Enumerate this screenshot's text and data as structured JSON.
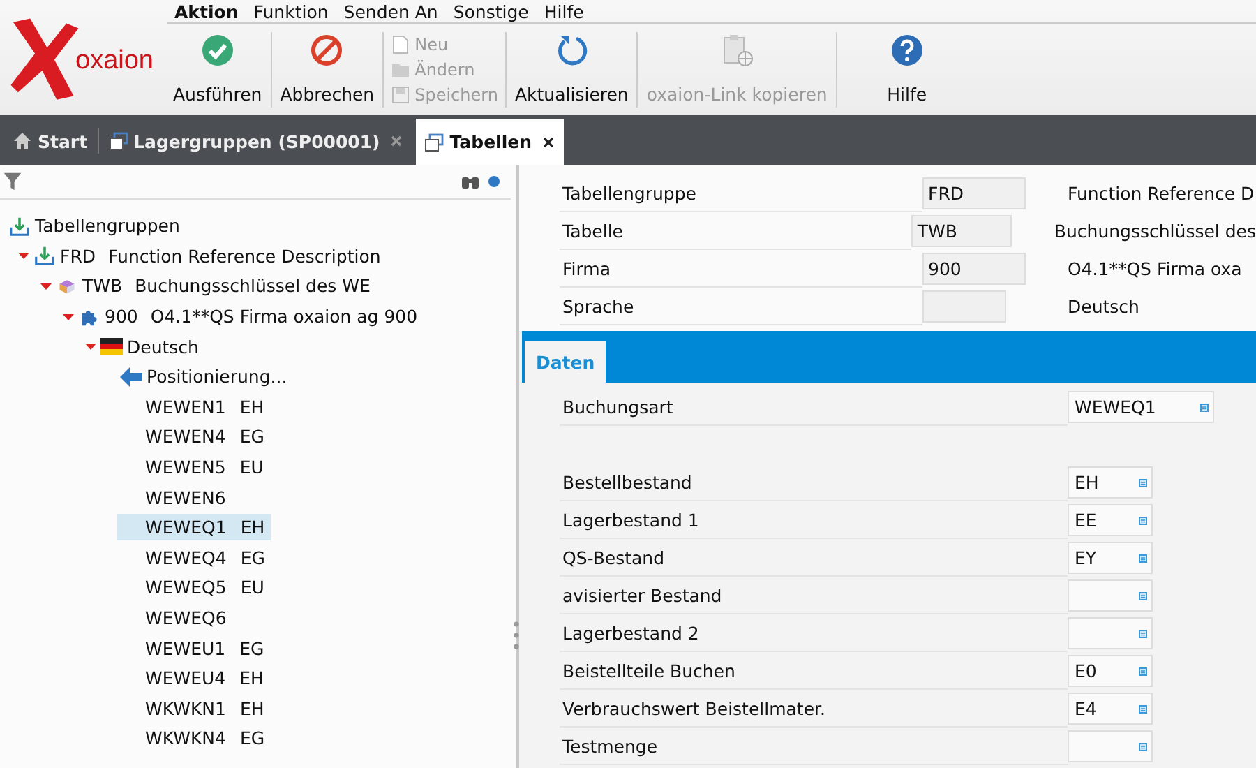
{
  "logo": {
    "text": "oxaion"
  },
  "menu": [
    {
      "label": "Aktion",
      "selected": true
    },
    {
      "label": "Funktion",
      "selected": false
    },
    {
      "label": "Senden An",
      "selected": false
    },
    {
      "label": "Sonstige",
      "selected": false
    },
    {
      "label": "Hilfe",
      "selected": false
    }
  ],
  "toolbar": [
    {
      "kind": "check",
      "label": "Ausführen",
      "disabled": false
    },
    {
      "kind": "cancel",
      "label": "Abbrechen",
      "disabled": false
    },
    {
      "kind": "stack",
      "items": [
        {
          "kind": "page",
          "label": "Neu",
          "disabled": true
        },
        {
          "kind": "folder",
          "label": "Ändern",
          "disabled": true
        },
        {
          "kind": "disk",
          "label": "Speichern",
          "disabled": true
        }
      ]
    },
    {
      "kind": "refresh",
      "label": "Aktualisieren",
      "disabled": false
    },
    {
      "kind": "clipboard",
      "label": "oxaion-Link kopieren",
      "disabled": true
    },
    {
      "kind": "help",
      "label": "Hilfe",
      "disabled": false
    }
  ],
  "tabs": [
    {
      "label": "Start",
      "kind": "home",
      "closable": false,
      "selected": false
    },
    {
      "label": "Lagergruppen (SP00001)",
      "kind": "windows",
      "closable": true,
      "selected": false
    },
    {
      "label": "Tabellen",
      "kind": "windows",
      "closable": true,
      "selected": true
    }
  ],
  "tree": [
    {
      "kind": "group",
      "label": "Tabellengruppen",
      "selected": false,
      "children": [
        {
          "kind": "group",
          "code": "FRD",
          "label": "Function Reference Description",
          "expanded": true,
          "selected": false,
          "children": [
            {
              "kind": "table",
              "code": "TWB",
              "label": "Buchungsschlüssel des WE",
              "expanded": true,
              "selected": false,
              "children": [
                {
                  "kind": "company",
                  "code": "900",
                  "label": "O4.1**QS Firma oxaion ag 900",
                  "expanded": true,
                  "selected": false,
                  "children": [
                    {
                      "kind": "language",
                      "label": "Deutsch",
                      "expanded": true,
                      "selected": false,
                      "children": [
                        {
                          "kind": "link",
                          "label": "Positionierung...",
                          "selected": false
                        },
                        {
                          "kind": "entry",
                          "code": "WEWEN1",
                          "label": "EH",
                          "selected": false
                        },
                        {
                          "kind": "entry",
                          "code": "WEWEN4",
                          "label": "EG",
                          "selected": false
                        },
                        {
                          "kind": "entry",
                          "code": "WEWEN5",
                          "label": "EU",
                          "selected": false
                        },
                        {
                          "kind": "entry",
                          "code": "WEWEN6",
                          "selected": false
                        },
                        {
                          "kind": "entry",
                          "code": "WEWEQ1",
                          "label": "EH",
                          "selected": true
                        },
                        {
                          "kind": "entry",
                          "code": "WEWEQ4",
                          "label": "EG",
                          "selected": false
                        },
                        {
                          "kind": "entry",
                          "code": "WEWEQ5",
                          "label": "EU",
                          "selected": false
                        },
                        {
                          "kind": "entry",
                          "code": "WEWEQ6",
                          "selected": false
                        },
                        {
                          "kind": "entry",
                          "code": "WEWEU1",
                          "label": "EG",
                          "selected": false
                        },
                        {
                          "kind": "entry",
                          "code": "WEWEU4",
                          "label": "EH",
                          "selected": false
                        },
                        {
                          "kind": "entry",
                          "code": "WKWKN1",
                          "label": "EH",
                          "selected": false
                        },
                        {
                          "kind": "entry",
                          "code": "WKWKN4",
                          "label": "EG",
                          "selected": false
                        }
                      ]
                    }
                  ]
                }
              ]
            }
          ]
        }
      ]
    }
  ],
  "header_fields": [
    {
      "label": "Tabellengruppe",
      "value": "FRD",
      "description": "Function Reference D"
    },
    {
      "label": "Tabelle",
      "value": "TWB",
      "description": "Buchungsschlüssel des"
    },
    {
      "label": "Firma",
      "value": "900",
      "description": "O4.1**QS Firma oxa"
    },
    {
      "label": "Sprache",
      "description": "Deutsch"
    }
  ],
  "detail_tabs": [
    {
      "label": "Daten",
      "selected": true
    }
  ],
  "key_field": {
    "label": "Buchungsart",
    "value": "WEWEQ1"
  },
  "fields": [
    {
      "label": "Bestellbestand",
      "value": "EH"
    },
    {
      "label": "Lagerbestand 1",
      "value": "EE"
    },
    {
      "label": "QS-Bestand",
      "value": "EY"
    },
    {
      "label": "avisierter Bestand"
    },
    {
      "label": "Lagerbestand 2"
    },
    {
      "label": "Beistellteile Buchen",
      "value": "E0"
    },
    {
      "label": "Verbrauchswert Beistellmater.",
      "value": "E4"
    },
    {
      "label": "Testmenge"
    }
  ]
}
